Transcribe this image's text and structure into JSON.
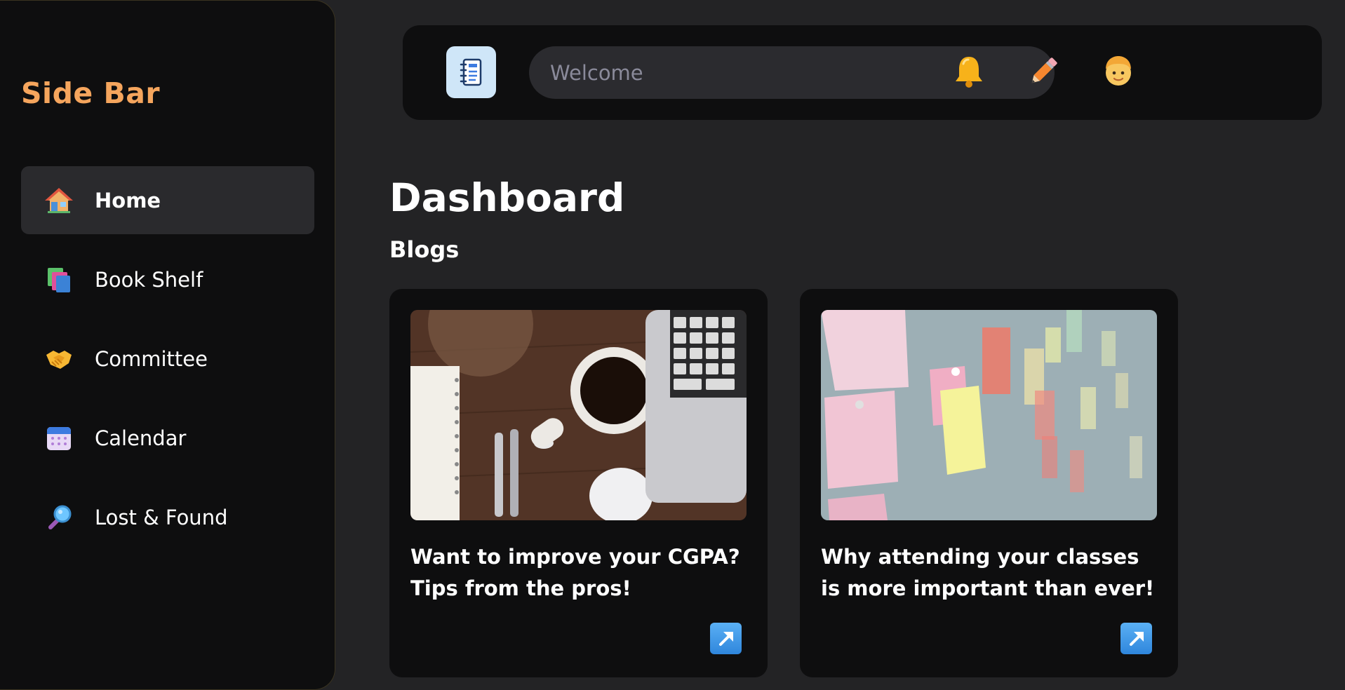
{
  "sidebar": {
    "title": "Side Bar",
    "items": [
      {
        "label": "Home",
        "icon": "house-icon",
        "active": true
      },
      {
        "label": "Book Shelf",
        "icon": "books-icon",
        "active": false
      },
      {
        "label": "Committee",
        "icon": "handshake-icon",
        "active": false
      },
      {
        "label": "Calendar",
        "icon": "calendar-icon",
        "active": false
      },
      {
        "label": "Lost & Found",
        "icon": "magnifying-glass-icon",
        "active": false
      }
    ]
  },
  "header": {
    "search_placeholder": "Welcome",
    "icons": [
      "notebook-logo-icon",
      "bell-icon",
      "pencil-icon",
      "avatar-icon"
    ]
  },
  "main": {
    "title": "Dashboard",
    "section_title": "Blogs",
    "cards": [
      {
        "title": "Want to improve your CGPA? Tips from the pros!",
        "image": "desk-coffee-laptop-photo"
      },
      {
        "title": "Why attending your classes is more important than ever!",
        "image": "sticky-notes-board-photo"
      }
    ]
  },
  "colors": {
    "background": "#232325",
    "panel": "#0e0e0f",
    "accent": "#f5a55d",
    "active_item": "#2a2a2d"
  }
}
